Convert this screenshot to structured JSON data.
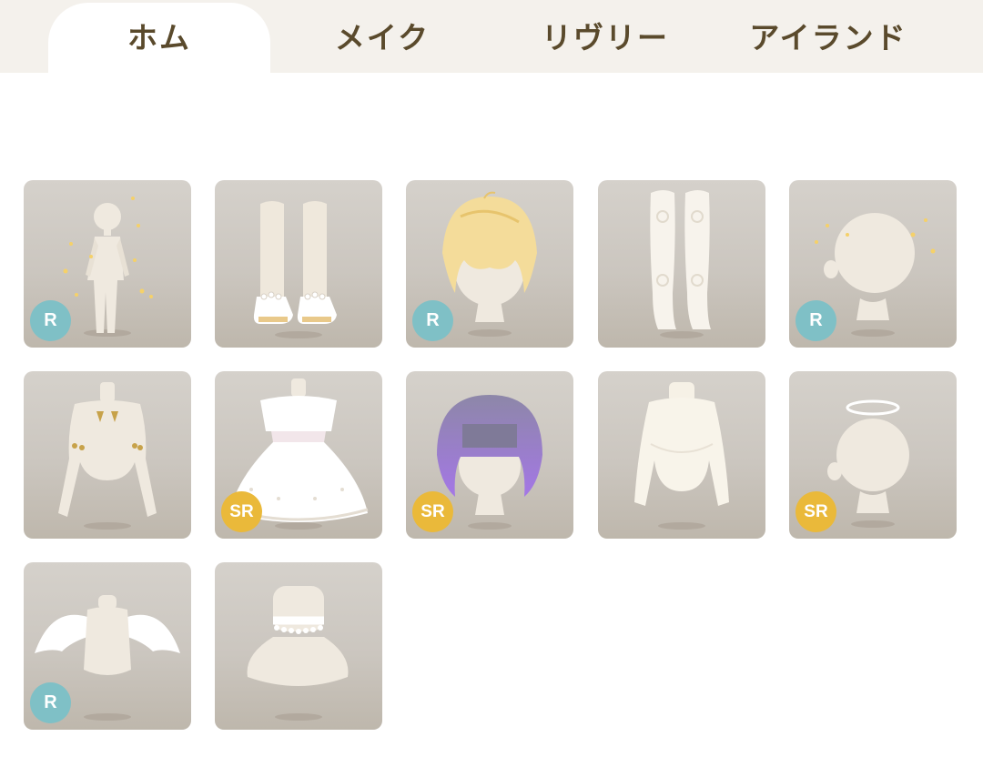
{
  "tabs": [
    {
      "label": "ホム",
      "active": true
    },
    {
      "label": "メイク",
      "active": false
    },
    {
      "label": "リヴリー",
      "active": false
    },
    {
      "label": "アイランド",
      "active": false
    }
  ],
  "items": [
    {
      "name": "sparkle-body",
      "rarity": "R"
    },
    {
      "name": "white-boots",
      "rarity": ""
    },
    {
      "name": "blonde-hair",
      "rarity": "R"
    },
    {
      "name": "white-tights",
      "rarity": ""
    },
    {
      "name": "sparkle-head",
      "rarity": "R"
    },
    {
      "name": "gold-accessory-top",
      "rarity": ""
    },
    {
      "name": "white-frill-dress",
      "rarity": "SR"
    },
    {
      "name": "purple-hair",
      "rarity": "SR"
    },
    {
      "name": "cream-sweater",
      "rarity": ""
    },
    {
      "name": "halo",
      "rarity": "SR"
    },
    {
      "name": "angel-wings",
      "rarity": "R"
    },
    {
      "name": "lace-choker",
      "rarity": ""
    }
  ],
  "colors": {
    "tabbar_bg": "#f4f1ec",
    "tab_text": "#5a4a2c",
    "rarity_r": "#7fc0c6",
    "rarity_sr": "#eab93a"
  }
}
